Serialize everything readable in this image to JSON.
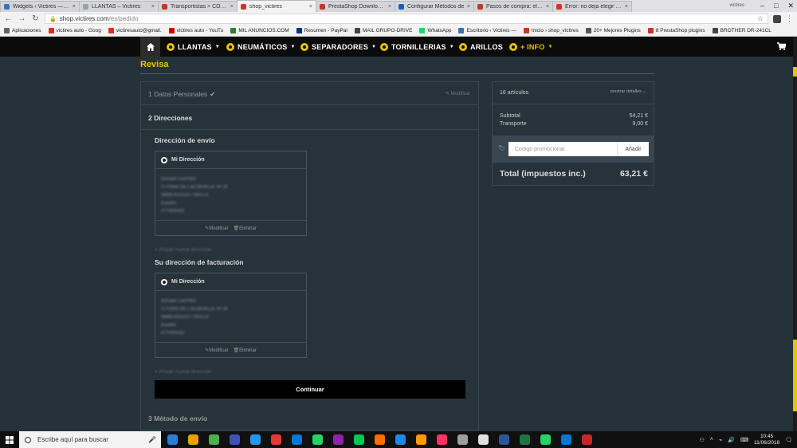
{
  "browser": {
    "tabs": [
      {
        "label": "Widgets ‹ Victires — Wo",
        "color": "#3d6fb5",
        "active": false
      },
      {
        "label": "LLANTAS – Victires",
        "color": "#9aa0a6",
        "active": false
      },
      {
        "label": "Transportistas > CORREC",
        "color": "#c0392b",
        "active": false
      },
      {
        "label": "shop_victires",
        "color": "#c0392b",
        "active": true
      },
      {
        "label": "PrestaShop Download: in",
        "color": "#c0392b",
        "active": false
      },
      {
        "label": "Configurar Métodos de ",
        "color": "#1e5fb3",
        "active": false
      },
      {
        "label": "Pasos de compra: elimin",
        "color": "#c0392b",
        "active": false
      },
      {
        "label": "Error: no deja elegir mét",
        "color": "#d93025",
        "active": false
      }
    ],
    "user_label": "victires",
    "url_host": "shop.victires.com",
    "url_path": "/es/pedido",
    "bookmarks": [
      {
        "label": "Aplicaciones",
        "color": "#5f6368"
      },
      {
        "label": "victires auto - Goog",
        "color": "#d93025"
      },
      {
        "label": "victiresauto@gmail.",
        "color": "#d93025"
      },
      {
        "label": "victires auto - YouTu",
        "color": "#cc0000"
      },
      {
        "label": "MIL ANUNCIOS.COM",
        "color": "#2e7d32"
      },
      {
        "label": "Resumen - PayPal",
        "color": "#003087"
      },
      {
        "label": "MAIL GRUPO-DRIVE",
        "color": "#444444"
      },
      {
        "label": "WhatsApp",
        "color": "#25d366"
      },
      {
        "label": "Escritorio ‹ Victires —",
        "color": "#3d6fb5"
      },
      {
        "label": "Inicio › shop_victires",
        "color": "#c0392b"
      },
      {
        "label": "20+ Mejores Plugins",
        "color": "#555555"
      },
      {
        "label": "8 PrestaShop plugins",
        "color": "#c0392b"
      },
      {
        "label": "BROTHER DR-241CL",
        "color": "#444444"
      }
    ]
  },
  "site_nav": {
    "items": [
      "LLANTAS",
      "NEUMÁTICOS",
      "SEPARADORES",
      "TORNILLERIAS",
      "ARILLOS",
      "+ INFO"
    ]
  },
  "page": {
    "title": "Revisa",
    "step1": {
      "label": "1 Datos Personales",
      "modify": "Modificar"
    },
    "step2": {
      "label": "2 Direcciones"
    },
    "shipping": {
      "title": "Dirección de envío",
      "card_label": "Mi Dirección",
      "lines": [
        "EDGAR CASTRO",
        "C/ FONS DE L'ALDEHILLA, Nº 28",
        "08800 EGUZO / DEILLE",
        "España",
        "677/605433"
      ],
      "modify": "Modificar",
      "delete": "Eliminar",
      "add_new": "Añadir nueva dirección"
    },
    "billing": {
      "title": "Su dirección de facturación",
      "card_label": "Mi Dirección",
      "lines": [
        "EDGAR CASTRO",
        "C/ FONS DE L'ALDEHILLA, Nº 28",
        "08800 EGUZO / DEILLE",
        "España",
        "677/605433"
      ],
      "modify": "Modificar",
      "delete": "Eliminar",
      "add_new": "Añadir nueva dirección"
    },
    "continue_label": "Continuar",
    "step3": {
      "label": "3 Método de envío"
    }
  },
  "summary": {
    "count": "16 artículos",
    "details_link": "mostrar detalles",
    "subtotal_label": "Subtotal",
    "subtotal_value": "54,21 €",
    "shipping_label": "Transporte",
    "shipping_value": "9,00 €",
    "promo_placeholder": "Código promocional",
    "promo_button": "Añadir",
    "total_label": "Total (impuestos inc.)",
    "total_value": "63,21 €"
  },
  "taskbar": {
    "search_placeholder": "Escribe aquí para buscar",
    "apps": [
      "#2d7dd2",
      "#e8a000",
      "#4caf50",
      "#3f51b5",
      "#2196f3",
      "#e53935",
      "#0078d4",
      "#25d366",
      "#8e24aa",
      "#00c853",
      "#ff6f00",
      "#1e88e5",
      "#ff9a00",
      "#ff3366",
      "#9e9e9e",
      "#e0e0e0",
      "#2b579a",
      "#217346",
      "#25d366",
      "#0078d4",
      "#c62828"
    ],
    "time": "10:45",
    "date": "11/06/2018"
  }
}
